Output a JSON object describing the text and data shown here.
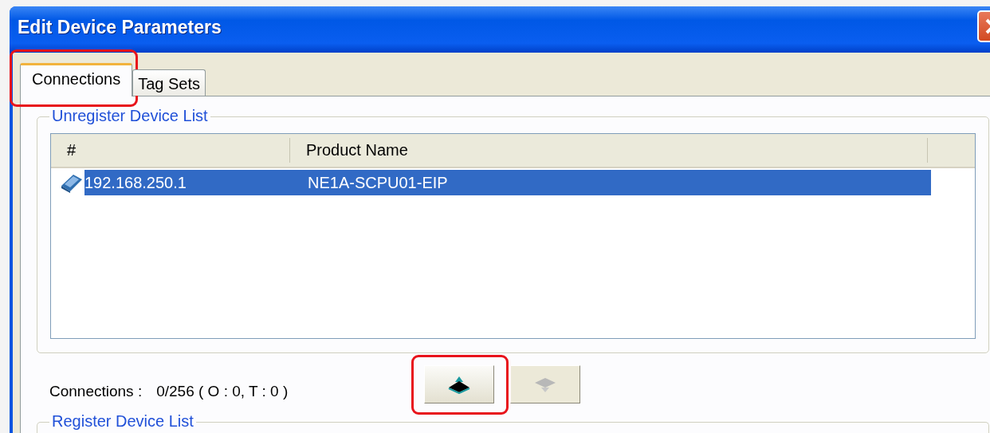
{
  "window": {
    "title": "Edit Device Parameters"
  },
  "tabs": [
    {
      "label": "Connections",
      "selected": true,
      "highlighted": true
    },
    {
      "label": "Tag Sets",
      "selected": false,
      "highlighted": false
    }
  ],
  "unregister_group": {
    "title": "Unregister Device List",
    "columns": [
      "#",
      "Product Name"
    ],
    "rows": [
      {
        "address": "192.168.250.1",
        "product_name": "NE1A-SCPU01-EIP",
        "selected": true
      }
    ]
  },
  "connections": {
    "label": "Connections :",
    "value": "0/256 ( O : 0, T : 0 )"
  },
  "buttons": [
    {
      "kind": "register",
      "disabled": false,
      "highlighted": true
    },
    {
      "kind": "unregister",
      "disabled": true,
      "highlighted": false
    }
  ],
  "register_group": {
    "title": "Register Device List"
  }
}
